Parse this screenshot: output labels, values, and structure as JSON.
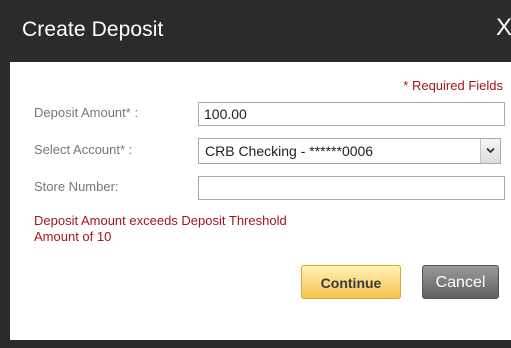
{
  "dialog": {
    "title": "Create Deposit",
    "close_label": "X"
  },
  "form": {
    "required_note": "* Required Fields",
    "deposit_amount_label": "Deposit Amount* :",
    "deposit_amount_value": "100.00",
    "select_account_label": "Select Account* :",
    "select_account_value": "CRB Checking - ******0006",
    "store_number_label": "Store Number:",
    "store_number_value": ""
  },
  "error": {
    "message": "Deposit Amount exceeds Deposit Threshold Amount of 10"
  },
  "buttons": {
    "continue_label": "Continue",
    "cancel_label": "Cancel"
  },
  "icons": {
    "close": "close-icon",
    "dropdown": "chevron-down-icon"
  },
  "colors": {
    "title_bar": "#2b2b2b",
    "error_text": "#a3161c",
    "continue_button": "#f6c44a",
    "cancel_button": "#5f5f5f"
  }
}
